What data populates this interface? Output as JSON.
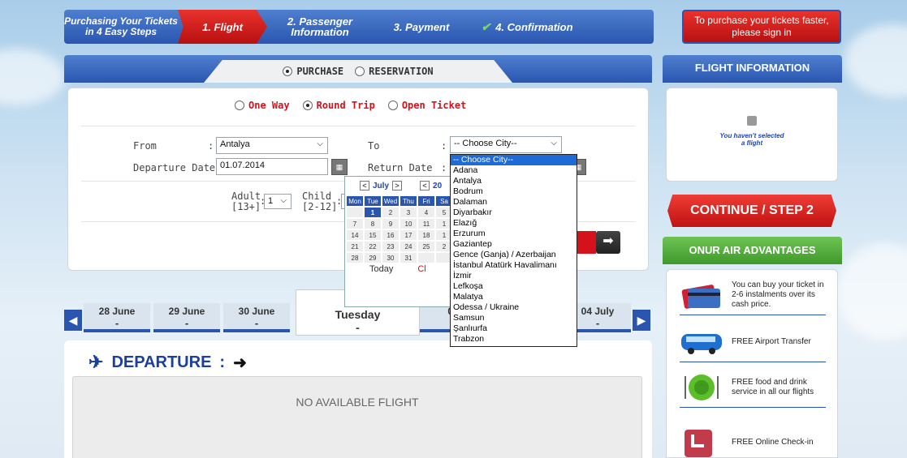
{
  "steps": {
    "intro": "Purchasing Your Tickets in 4 Easy Steps",
    "step1": "1. Flight",
    "step2": "2. Passenger Information",
    "step3": "3. Payment",
    "step4": "4. Confirmation",
    "signin": "To purchase your tickets faster, please sign in"
  },
  "tabs": {
    "purchase": "PURCHASE",
    "reservation": "RESERVATION"
  },
  "trip": {
    "one_way": "One Way",
    "round_trip": "Round Trip",
    "open_ticket": "Open Ticket"
  },
  "form": {
    "from_label": "From",
    "from_value": "Antalya",
    "to_label": "To",
    "to_value": "-- Choose City--",
    "departure_label": "Departure Date:",
    "departure_value": "01.07.2014",
    "return_label": "Return Date",
    "adult_label": "Adult",
    "adult_range": "[13+]",
    "adult_value": "1",
    "child_label": "Child",
    "child_range": "[2-12]"
  },
  "calendar": {
    "month": "July",
    "year_prefix": "20",
    "weekdays": [
      "Mon",
      "Tue",
      "Wed",
      "Thu",
      "Fri",
      "Sa"
    ],
    "rows": [
      [
        "",
        "1",
        "2",
        "3",
        "4",
        "5"
      ],
      [
        "7",
        "8",
        "9",
        "10",
        "11",
        "1"
      ],
      [
        "14",
        "15",
        "16",
        "17",
        "18",
        "1"
      ],
      [
        "21",
        "22",
        "23",
        "24",
        "25",
        "2"
      ],
      [
        "28",
        "29",
        "30",
        "31",
        "",
        ""
      ]
    ],
    "today": "Today",
    "close": "Cl"
  },
  "cities": [
    "-- Choose City--",
    "Adana",
    "Antalya",
    "Bodrum",
    "Dalaman",
    "Diyarbakır",
    "Elazığ",
    "Erzurum",
    "Gaziantep",
    "Gence (Ganja) / Azerbaijan",
    "İstanbul Atatürk Havalimanı",
    "İzmir",
    "Lefkoşa",
    "Malatya",
    "Odessa / Ukraine",
    "Samsun",
    "Şanlıurfa",
    "Trabzon"
  ],
  "dates": {
    "d1": "28 June",
    "d2": "29 June",
    "d3": "30 June",
    "sel_date": "01 J",
    "sel_day": "Tuesday",
    "sel_dash": "-",
    "d5": "02",
    "d7": "04 July",
    "dash": "-"
  },
  "departure": {
    "title": "DEPARTURE",
    "colon": ":",
    "no_flight": "NO AVAILABLE FLIGHT"
  },
  "flight_info": {
    "title": "FLIGHT INFORMATION",
    "empty": "You haven't selected a flight"
  },
  "continue_label": "CONTINUE / STEP 2",
  "advantages": {
    "title": "ONUR AIR ADVANTAGES",
    "items": [
      "You can buy your ticket in 2-6 instalments over its cash price.",
      "FREE Airport Transfer",
      "FREE food and drink service in all our flights",
      "FREE Online Check-in"
    ]
  }
}
